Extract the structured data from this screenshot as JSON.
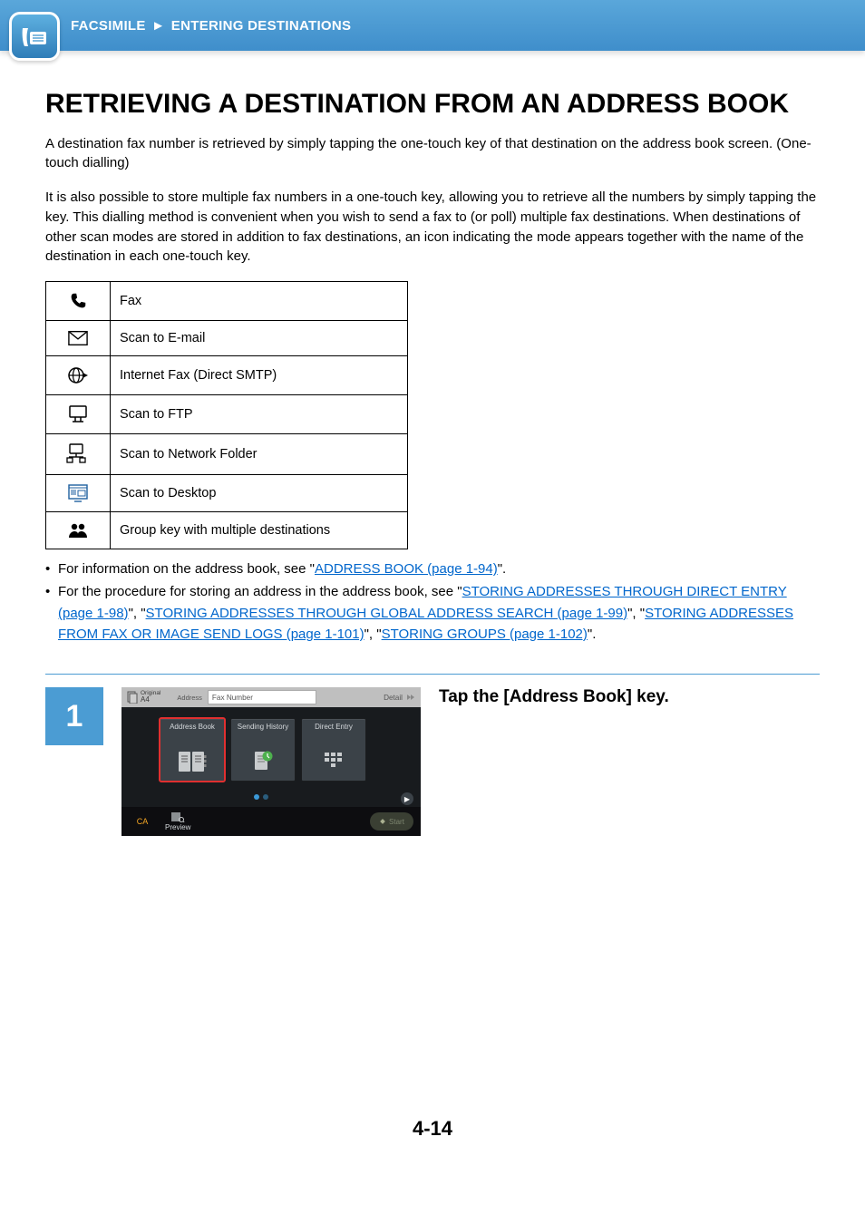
{
  "header": {
    "breadcrumb1": "FACSIMILE",
    "breadcrumb2": "ENTERING DESTINATIONS"
  },
  "title": "RETRIEVING A DESTINATION FROM AN ADDRESS BOOK",
  "para1": "A destination fax number is retrieved by simply tapping the one-touch key of that destination on the address book screen. (One-touch dialling)",
  "para2": "It is also possible to store multiple fax numbers in a one-touch key, allowing you to retrieve all the numbers by simply tapping the key. This dialling method is convenient when you wish to send a fax to (or poll) multiple fax destinations. When destinations of other scan modes are stored in addition to fax destinations, an icon indicating the mode appears together with the name of the destination in each one-touch key.",
  "modes": [
    {
      "label": "Fax"
    },
    {
      "label": "Scan to E-mail"
    },
    {
      "label": "Internet Fax (Direct SMTP)"
    },
    {
      "label": "Scan to FTP"
    },
    {
      "label": "Scan to Network Folder"
    },
    {
      "label": "Scan to Desktop"
    },
    {
      "label": "Group key with multiple destinations"
    }
  ],
  "refs": {
    "b1_a": "For information on the address book, see \"",
    "b1_link": "ADDRESS BOOK (page 1-94)",
    "b1_z": "\".",
    "b2_a": "For the procedure for storing an address in the address book, see \"",
    "b2_l1": "STORING ADDRESSES THROUGH DIRECT ENTRY (page 1-98)",
    "b2_m1": "\", \"",
    "b2_l2": "STORING ADDRESSES THROUGH GLOBAL ADDRESS SEARCH (page 1-99)",
    "b2_m2": "\", \"",
    "b2_l3": "STORING ADDRESSES FROM FAX OR IMAGE SEND LOGS (page 1-101)",
    "b2_m3": "\", \"",
    "b2_l4": "STORING GROUPS (page 1-102)",
    "b2_z": "\"."
  },
  "step": {
    "num": "1",
    "instruction": "Tap the [Address Book] key.",
    "panel": {
      "orig_lbl": "Original",
      "orig_size": "A4",
      "addr_lbl": "Address",
      "addr_ph": "Fax Number",
      "detail": "Detail",
      "btn1": "Address Book",
      "btn2": "Sending History",
      "btn3": "Direct Entry",
      "ca": "CA",
      "preview": "Preview",
      "start": "Start"
    }
  },
  "page_num": "4-14"
}
